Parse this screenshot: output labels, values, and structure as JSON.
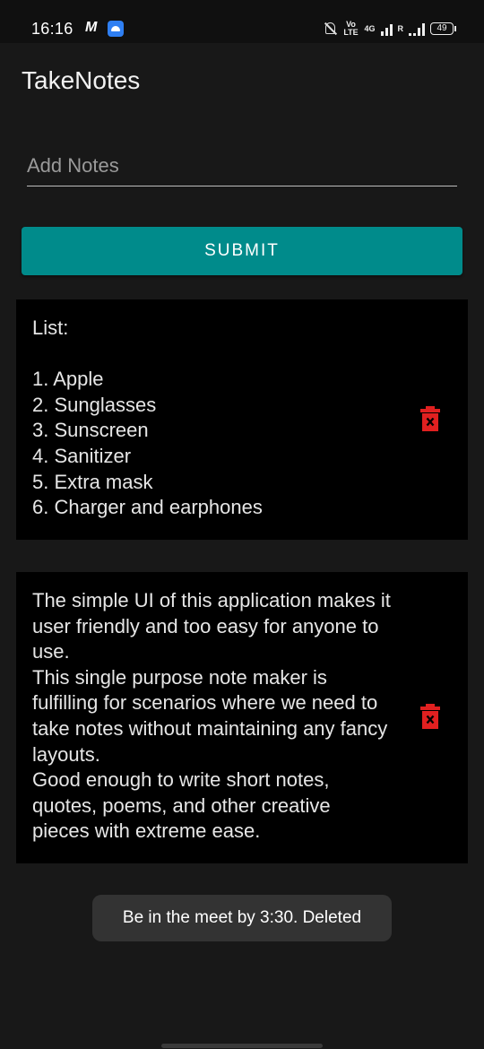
{
  "status_bar": {
    "time": "16:16",
    "m_label": "M",
    "volte_label": "Vo LTE",
    "network_label": "4G",
    "roaming_label": "R",
    "battery": "49"
  },
  "app": {
    "title": "TakeNotes"
  },
  "input": {
    "value": "",
    "placeholder": "Add Notes"
  },
  "submit": {
    "label": "SUBMIT"
  },
  "notes": [
    {
      "text": "List:\n\n1. Apple\n2. Sunglasses\n3. Sunscreen\n4. Sanitizer\n5. Extra mask\n6. Charger and earphones"
    },
    {
      "text": "The simple UI of this application makes it user friendly and too easy for anyone to use.\nThis single purpose note maker is fulfilling for scenarios where we need to take notes without maintaining any fancy layouts.\nGood enough to write short notes, quotes, poems, and other creative pieces with extreme ease."
    }
  ],
  "toast": {
    "message": "Be in the meet by 3:30. Deleted"
  },
  "colors": {
    "accent": "#008b8b",
    "delete": "#e02020",
    "background": "#181818",
    "card": "#000000"
  },
  "icons": {
    "delete": "trash-x-icon",
    "notifications_off": "bell-off-icon",
    "signal": "signal-bars-icon",
    "battery": "battery-icon"
  }
}
